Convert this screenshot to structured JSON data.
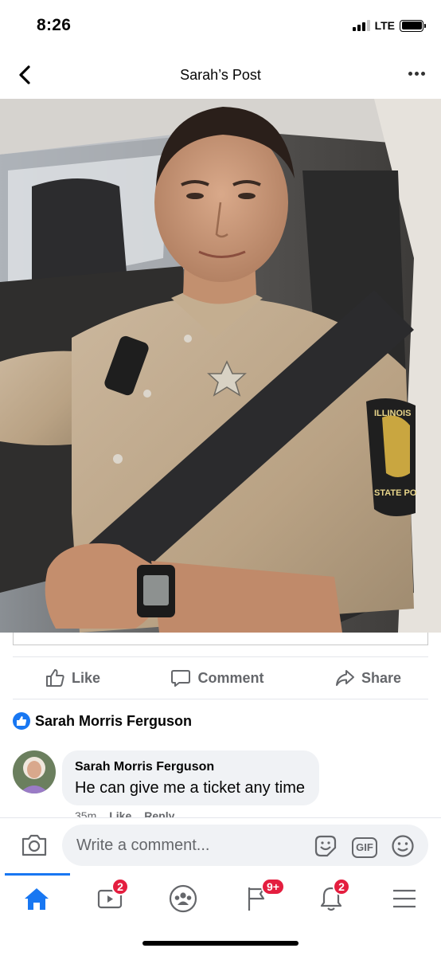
{
  "status_bar": {
    "time": "8:26",
    "network": "LTE",
    "signal_bars_filled": 3,
    "signal_bars_total": 4
  },
  "nav": {
    "title": "Sarah’s Post",
    "back_icon": "chevron-left-icon",
    "more_icon": "more-horizontal-icon"
  },
  "post": {
    "photo_description_icon": "photo",
    "patch_text_top": "ILLINOIS",
    "patch_text_bottom": "STATE PO"
  },
  "actions": {
    "like_label": "Like",
    "comment_label": "Comment",
    "share_label": "Share"
  },
  "reactions": {
    "reactor_name": "Sarah Morris Ferguson",
    "reaction_icon": "like-badge-icon"
  },
  "comments": [
    {
      "author": "Sarah Morris Ferguson",
      "text": "He can give me a ticket any time",
      "time": "35m",
      "like_label": "Like",
      "reply_label": "Reply"
    }
  ],
  "composer": {
    "placeholder": "Write a comment...",
    "gif_label": "GIF"
  },
  "tabs": [
    {
      "name": "home",
      "icon": "home-icon",
      "badge": ""
    },
    {
      "name": "watch",
      "icon": "video-icon",
      "badge": "2"
    },
    {
      "name": "groups",
      "icon": "groups-icon",
      "badge": ""
    },
    {
      "name": "pages",
      "icon": "flag-icon",
      "badge": "9+"
    },
    {
      "name": "notifications",
      "icon": "bell-icon",
      "badge": "2"
    },
    {
      "name": "menu",
      "icon": "menu-icon",
      "badge": ""
    }
  ],
  "colors": {
    "accent": "#1877f2",
    "badge": "#e41e3f",
    "secondary_text": "#65676b",
    "bubble_bg": "#f0f2f5"
  }
}
